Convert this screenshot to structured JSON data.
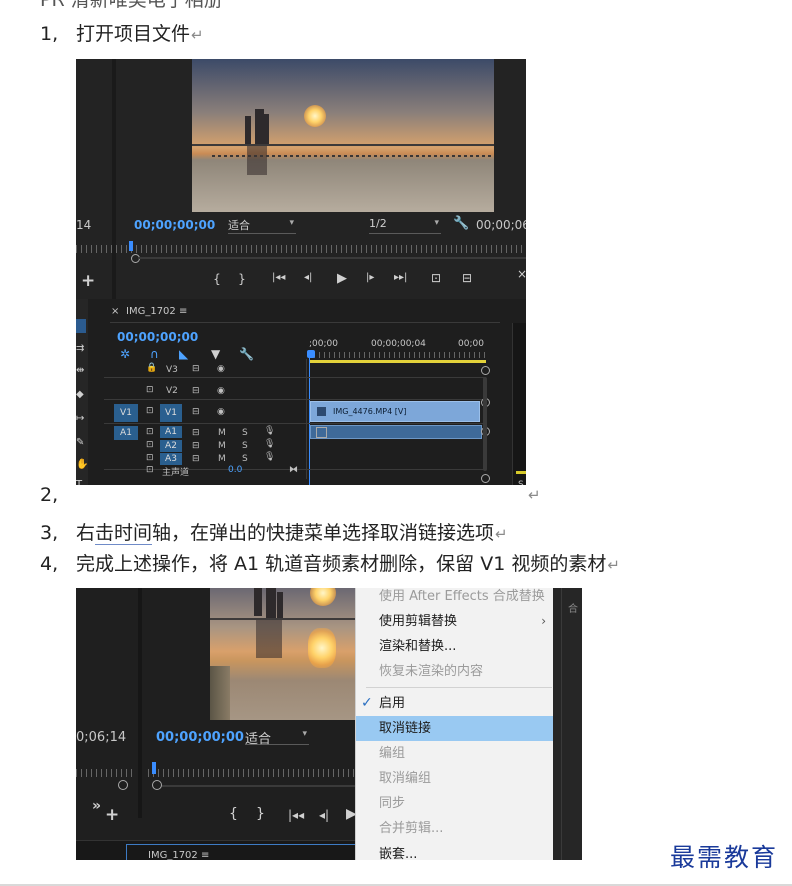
{
  "document": {
    "top_cut_text": "PR 清新唯美电子相册",
    "steps": [
      {
        "num": "1,",
        "text": "打开项目文件"
      },
      {
        "num": "2,",
        "text": ""
      },
      {
        "num": "3,",
        "text_before": "右",
        "text_underlined": "击时间",
        "text_after": "轴，在弹出的快捷菜单选择取消链接选项"
      },
      {
        "num": "4,",
        "text": "完成上述操作，将 A1 轨道音频素材删除，保留 V1 视频的素材"
      }
    ],
    "paragraph_mark": "↵",
    "logo_text": "最需教育"
  },
  "screenshot1": {
    "left_edge_tc": "14",
    "program_timecode": "00;00;00;00",
    "fit_label": "适合",
    "resolution_label": "1/2",
    "program_duration": "00;00;06",
    "transport": [
      "{",
      "}",
      "|◂◂",
      "◂|",
      "▶",
      "|▸",
      "▸▸|",
      "⊡",
      "⊟"
    ],
    "sequence_tab": "IMG_1702",
    "sequence_menu": "≡",
    "sequence_timecode": "00;00;00;00",
    "ruler_labels": [
      ";00;00",
      "00;00;00;04",
      "00;00"
    ],
    "tracks": [
      {
        "id": "V3",
        "source": "",
        "lock": "🔒",
        "toggle": "◉"
      },
      {
        "id": "V2",
        "source": "",
        "lock": "🔓",
        "toggle": "◉"
      },
      {
        "id": "V1",
        "source": "V1",
        "lock": "🔓",
        "toggle": "◉"
      },
      {
        "id": "A1",
        "source": "A1",
        "m": "M",
        "s": "S"
      },
      {
        "id": "A2",
        "source": "",
        "m": "M",
        "s": "S"
      },
      {
        "id": "A3",
        "source": "",
        "m": "M",
        "s": "S"
      }
    ],
    "master_label": "主声道",
    "master_value": "0.0",
    "video_clip_label": "IMG_4476.MP4 [V]",
    "right_panel_letter": "S",
    "close_glyph": "×",
    "add_glyph": "+"
  },
  "screenshot2": {
    "left_tc": "0;06;14",
    "program_timecode": "00;00;00;00",
    "fit_label": "适合",
    "sequence_tab": "IMG_1702 ≡",
    "side_text": "合",
    "context_menu": [
      {
        "label": "使用 After Effects 合成替换",
        "disabled": true
      },
      {
        "label": "使用剪辑替换",
        "disabled": false,
        "submenu": true
      },
      {
        "label": "渲染和替换...",
        "disabled": false
      },
      {
        "label": "恢复未渲染的内容",
        "disabled": true
      },
      {
        "separator": true
      },
      {
        "label": "启用",
        "disabled": false,
        "checked": true
      },
      {
        "label": "取消链接",
        "disabled": false,
        "highlighted": true
      },
      {
        "label": "编组",
        "disabled": true
      },
      {
        "label": "取消编组",
        "disabled": true
      },
      {
        "label": "同步",
        "disabled": true
      },
      {
        "label": "合并剪辑...",
        "disabled": true
      },
      {
        "label": "嵌套...",
        "disabled": false
      }
    ],
    "submenu_glyph": "›",
    "check_glyph": "✓"
  },
  "colors": {
    "timecode_blue": "#4ea3ff",
    "menu_highlight": "#99c9f2",
    "logo_blue": "#1a3a9a",
    "clip_blue": "#7da7d9"
  }
}
